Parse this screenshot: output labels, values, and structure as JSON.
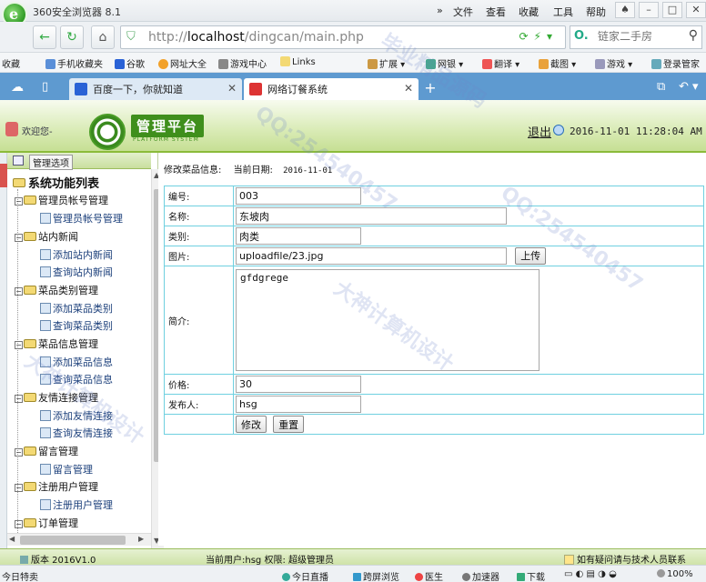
{
  "browser": {
    "app_title": "360安全浏览器 8.1",
    "menu": [
      "文件",
      "查看",
      "收藏",
      "工具",
      "帮助"
    ],
    "url_prefix": "http://",
    "url_host": "localhost",
    "url_path": "/dingcan/main.php",
    "search_placeholder": "链家二手房",
    "favorites": [
      "收藏",
      "手机收藏夹",
      "谷歌",
      "网址大全",
      "游戏中心",
      "Links",
      "扩展",
      "网银",
      "翻译",
      "截图",
      "游戏",
      "登录管家"
    ],
    "tabs": [
      {
        "label": "百度一下，你就知道",
        "active": false
      },
      {
        "label": "网络订餐系统",
        "active": true
      }
    ],
    "status_items": [
      "今日特卖",
      "今日直播",
      "跨屏浏览",
      "医生",
      "加速器",
      "下载",
      "100%"
    ]
  },
  "header": {
    "welcome": "欢迎您-",
    "platform_title": "管理平台",
    "platform_subtitle": "PLATFORM SYSTEM",
    "logout": "退出",
    "datetime": "2016-11-01 11:28:04 AM"
  },
  "sidebar": {
    "header_label": "管理选项",
    "root": "系统功能列表",
    "groups": [
      {
        "label": "管理员帐号管理",
        "items": [
          "管理员帐号管理"
        ]
      },
      {
        "label": "站内新闻",
        "items": [
          "添加站内新闻",
          "查询站内新闻"
        ]
      },
      {
        "label": "菜品类别管理",
        "items": [
          "添加菜品类别",
          "查询菜品类别"
        ]
      },
      {
        "label": "菜品信息管理",
        "items": [
          "添加菜品信息",
          "查询菜品信息"
        ]
      },
      {
        "label": "友情连接管理",
        "items": [
          "添加友情连接",
          "查询友情连接"
        ]
      },
      {
        "label": "留言管理",
        "items": [
          "留言管理"
        ]
      },
      {
        "label": "注册用户管理",
        "items": [
          "注册用户管理"
        ]
      },
      {
        "label": "订单管理",
        "items": []
      }
    ]
  },
  "main": {
    "breadcrumb": "修改菜品信息:",
    "date_label": "当前日期:",
    "date_value": "2016-11-01",
    "fields": {
      "id": {
        "label": "编号:",
        "value": "003"
      },
      "name": {
        "label": "名称:",
        "value": "东坡肉"
      },
      "category": {
        "label": "类别:",
        "value": "肉类"
      },
      "image": {
        "label": "图片:",
        "value": "uploadfile/23.jpg",
        "upload_button": "上传"
      },
      "intro": {
        "label": "简介:",
        "value": "gfdgrege"
      },
      "price": {
        "label": "价格:",
        "value": "30"
      },
      "publisher": {
        "label": "发布人:",
        "value": "hsg"
      }
    },
    "submit_button": "修改",
    "reset_button": "重置"
  },
  "statusbar": {
    "version": "版本 2016V1.0",
    "current_user": "当前用户:hsg 权限: 超级管理员",
    "help": "如有疑问请与技术人员联系"
  },
  "watermark": [
    "大神计算机设计",
    "QQ:254540457",
    "毕业精品源码",
    "QQ:254540457",
    "大神计算机设计"
  ],
  "colors": {
    "accent_green": "#3f8f1c",
    "table_border": "#6fd0e0",
    "tab_bar": "#5e9ad0"
  }
}
